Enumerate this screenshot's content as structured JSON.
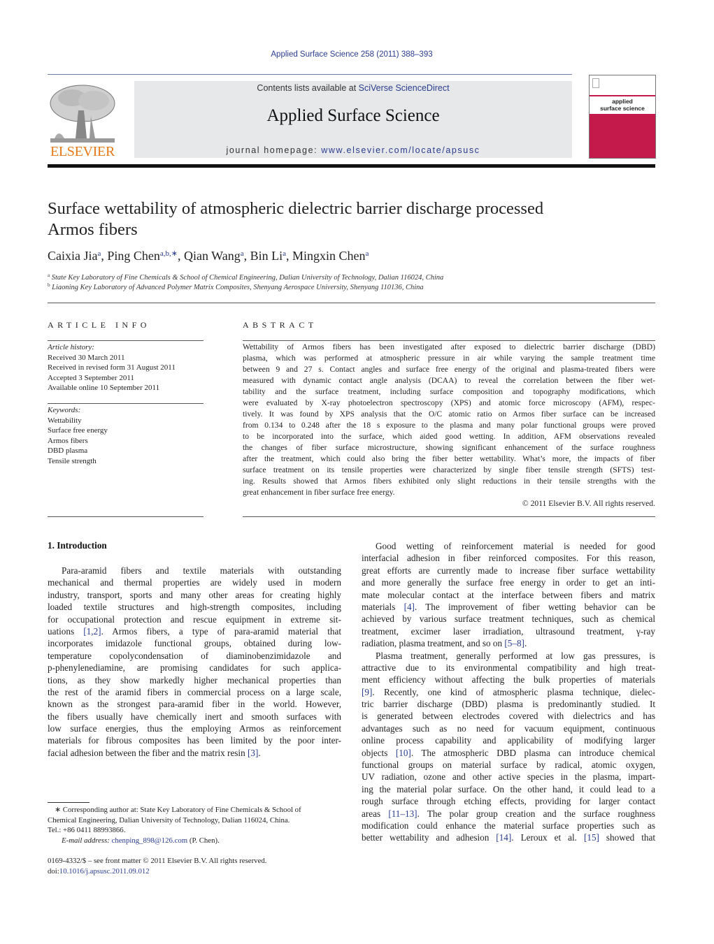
{
  "header": {
    "citation": "Applied Surface Science 258 (2011) 388–393",
    "contents_prefix": "Contents lists available at ",
    "contents_link": "SciVerse ScienceDirect",
    "journal_name": "Applied Surface Science",
    "homepage_prefix": "journal homepage: ",
    "homepage_link": "www.elsevier.com/locate/apsusc",
    "publisher_logo_text": "ELSEVIER",
    "cover_title_line1": "applied",
    "cover_title_line2": "surface science",
    "colors": {
      "link": "#2a3c8f",
      "elsevier_orange": "#e77817",
      "cover_magenta": "#c31a4b",
      "banner_bg": "#e7e8ea"
    }
  },
  "article": {
    "title_line1": "Surface wettability of atmospheric dielectric barrier discharge processed",
    "title_line2": "Armos fibers",
    "authors": [
      {
        "name": "Caixia Jia",
        "sup": "a"
      },
      {
        "name": "Ping Chen",
        "sup": "a,b,∗"
      },
      {
        "name": "Qian Wang",
        "sup": "a"
      },
      {
        "name": "Bin Li",
        "sup": "a"
      },
      {
        "name": "Mingxin Chen",
        "sup": "a"
      }
    ],
    "affiliations": [
      {
        "mark": "a",
        "text": "State Key Laboratory of Fine Chemicals & School of Chemical Engineering, Dalian University of Technology, Dalian 116024, China"
      },
      {
        "mark": "b",
        "text": "Liaoning Key Laboratory of Advanced Polymer Matrix Composites, Shenyang Aerospace University, Shenyang 110136, China"
      }
    ]
  },
  "article_info": {
    "heading": "ARTICLE INFO",
    "history_label": "Article history:",
    "history": [
      "Received 30 March 2011",
      "Received in revised form 31 August 2011",
      "Accepted 3 September 2011",
      "Available online 10 September 2011"
    ],
    "keywords_label": "Keywords:",
    "keywords": [
      "Wettability",
      "Surface free energy",
      "Armos fibers",
      "DBD plasma",
      "Tensile strength"
    ]
  },
  "abstract": {
    "heading": "ABSTRACT",
    "lines": [
      "Wettability of Armos fibers has been investigated after exposed to dielectric barrier discharge (DBD)",
      "plasma, which was performed at atmospheric pressure in air while varying the sample treatment time",
      "between 9 and 27 s. Contact angles and surface free energy of the original and plasma-treated fibers were",
      "measured with dynamic contact angle analysis (DCAA) to reveal the correlation between the fiber wet-",
      "tability and the surface treatment, including surface composition and topography modifications, which",
      "were evaluated by X-ray photoelectron spectroscopy (XPS) and atomic force microscopy (AFM), respec-",
      "tively. It was found by XPS analysis that the O/C atomic ratio on Armos fiber surface can be increased",
      "from 0.134 to 0.248 after the 18 s exposure to the plasma and many polar functional groups were proved",
      "to be incorporated into the surface, which aided good wetting. In addition, AFM observations revealed",
      "the changes of fiber surface microstructure, showing significant enhancement of the surface roughness",
      "after the treatment, which could also bring the fiber better wettability. What’s more, the impacts of fiber",
      "surface treatment on its tensile properties were characterized by single fiber tensile strength (SFTS) test-",
      "ing. Results showed that Armos fibers exhibited only slight reductions in their tensile strengths with the",
      "great enhancement in fiber surface free energy."
    ],
    "copyright": "© 2011 Elsevier B.V. All rights reserved."
  },
  "introduction": {
    "heading": "1.  Introduction",
    "left_column": [
      {
        "t": "Para-aramid fibers and textile materials with outstanding",
        "indent": true
      },
      {
        "t": "mechanical and thermal properties are widely used in modern"
      },
      {
        "t": "industry, transport, sports and many other areas for creating highly"
      },
      {
        "t": "loaded textile structures and high-strength composites, including"
      },
      {
        "t": "for occupational protection and rescue equipment in extreme sit-"
      },
      {
        "t": "uations [1,2]. Armos fibers, a type of para-aramid material that"
      },
      {
        "t": "incorporates imidazole functional groups, obtained during low-"
      },
      {
        "t": "temperature copolycondensation of diaminobenzimidazole and"
      },
      {
        "t": "p-phenylenediamine, are promising candidates for such applica-"
      },
      {
        "t": "tions, as they show markedly higher mechanical properties than"
      },
      {
        "t": "the rest of the aramid fibers in commercial process on a large scale,"
      },
      {
        "t": "known as the strongest para-aramid fiber in the world. However,"
      },
      {
        "t": "the fibers usually have chemically inert and smooth surfaces with"
      },
      {
        "t": "low surface energies, thus the employing Armos as reinforcement"
      },
      {
        "t": "materials for fibrous composites has been limited by the poor inter-"
      },
      {
        "t": "facial adhesion between the fiber and the matrix resin [3].",
        "last": true
      }
    ],
    "right_column": [
      {
        "t": "Good wetting of reinforcement material is needed for good",
        "indent": true
      },
      {
        "t": "interfacial adhesion in fiber reinforced composites. For this reason,"
      },
      {
        "t": "great efforts are currently made to increase fiber surface wettability"
      },
      {
        "t": "and more generally the surface free energy in order to get an inti-"
      },
      {
        "t": "mate molecular contact at the interface between fibers and matrix"
      },
      {
        "t": "materials [4]. The improvement of fiber wetting behavior can be"
      },
      {
        "t": "achieved by various surface treatment techniques, such as chemical"
      },
      {
        "t": "treatment, excimer laser irradiation, ultrasound treatment, γ-ray"
      },
      {
        "t": "radiation, plasma treatment, and so on [5–8].",
        "last": true
      },
      {
        "t": "Plasma treatment, generally performed at low gas pressures, is",
        "indent": true
      },
      {
        "t": "attractive due to its environmental compatibility and high treat-"
      },
      {
        "t": "ment efficiency without affecting the bulk properties of materials"
      },
      {
        "t": "[9]. Recently, one kind of atmospheric plasma technique, dielec-"
      },
      {
        "t": "tric barrier discharge (DBD) plasma is predominantly studied. It"
      },
      {
        "t": "is generated between electrodes covered with dielectrics and has"
      },
      {
        "t": "advantages such as no need for vacuum equipment, continuous"
      },
      {
        "t": "online process capability and applicability of modifying larger"
      },
      {
        "t": "objects [10]. The atmospheric DBD plasma can introduce chemical"
      },
      {
        "t": "functional groups on material surface by radical, atomic oxygen,"
      },
      {
        "t": "UV radiation, ozone and other active species in the plasma, impart-"
      },
      {
        "t": "ing the material polar surface. On the other hand, it could lead to a"
      },
      {
        "t": "rough surface through etching effects, providing for larger contact"
      },
      {
        "t": "areas [11–13]. The polar group creation and the surface roughness"
      },
      {
        "t": "modification could enhance the material surface properties such as"
      },
      {
        "t": "better wettability and adhesion [14]. Leroux et al. [15] showed that"
      }
    ]
  },
  "footnotes": {
    "corresponding_line1": "∗ Corresponding author at: State Key Laboratory of Fine Chemicals & School of",
    "corresponding_line2": "Chemical Engineering, Dalian University of Technology, Dalian 116024, China.",
    "tel": "Tel.: +86 0411 88993866.",
    "email_label": "E-mail address: ",
    "email": "chenping_898@126.com",
    "email_suffix": " (P. Chen).",
    "issn": "0169-4332/$ – see front matter © 2011 Elsevier B.V. All rights reserved.",
    "doi_prefix": "doi:",
    "doi": "10.1016/j.apsusc.2011.09.012"
  }
}
